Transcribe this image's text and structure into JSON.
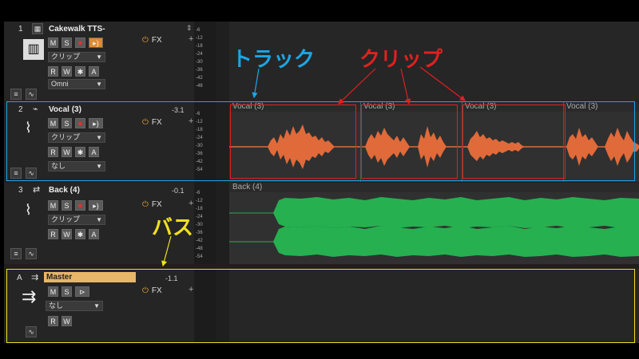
{
  "annotations": {
    "track": "トラック",
    "clip": "クリップ",
    "bus": "バス"
  },
  "tracks": [
    {
      "number": "1",
      "name": "Cakewalk TTS-",
      "preset": "クリップ",
      "input": "Omni",
      "volume": "",
      "fx": "FX"
    },
    {
      "number": "2",
      "name": "Vocal (3)",
      "preset": "クリップ",
      "input": "なし",
      "volume": "-3.1",
      "fx": "FX"
    },
    {
      "number": "3",
      "name": "Back (4)",
      "preset": "クリップ",
      "input": "",
      "volume": "-0.1",
      "fx": "FX"
    }
  ],
  "bus": {
    "letter": "A",
    "name": "Master",
    "preset": "なし",
    "volume": "-1.1",
    "fx": "FX"
  },
  "buttons": {
    "mute": "M",
    "solo": "S",
    "read": "R",
    "write": "W",
    "star": "✱",
    "auto": "A"
  },
  "clips": {
    "vocal": [
      "Vocal (3)",
      "Vocal (3)",
      "Vocal (3)",
      "Vocal (3)"
    ],
    "back": "Back (4)"
  },
  "meter_ticks": [
    "-6",
    "-12",
    "-18",
    "-24",
    "-30",
    "-36",
    "-42",
    "-48",
    "-54"
  ],
  "colors": {
    "track_annot": "#1aa7e6",
    "clip_annot": "#e02020",
    "bus_annot": "#f0e020",
    "vocal_wave": "#e06a3a",
    "back_wave": "#26b050",
    "master_name_bg": "#e8b668"
  }
}
